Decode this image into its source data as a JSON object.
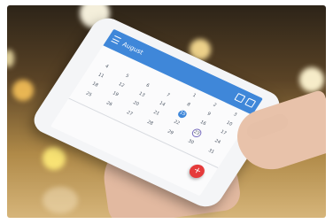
{
  "photo": {
    "scene": "hands holding smartphone with calendar app",
    "background_tone": "#b08a48"
  },
  "app": {
    "month_label": "August",
    "accent_color": "#3f87d9",
    "fab_color": "#e53b3b",
    "fab_symbol": "+",
    "icons": [
      "menu-icon",
      "calendar-icon",
      "share-icon"
    ]
  },
  "calendar": {
    "days": [
      "",
      "",
      "",
      "",
      "1",
      "2",
      "3",
      "4",
      "5",
      "6",
      "7",
      "8",
      "9",
      "10",
      "11",
      "12",
      "13",
      "14",
      "15",
      "16",
      "17",
      "18",
      "19",
      "20",
      "21",
      "22",
      "23",
      "24",
      "25",
      "26",
      "27",
      "28",
      "29",
      "30",
      "31"
    ],
    "today": "15",
    "ringed_day": "23"
  },
  "detail": {
    "note": "",
    "date": ""
  }
}
